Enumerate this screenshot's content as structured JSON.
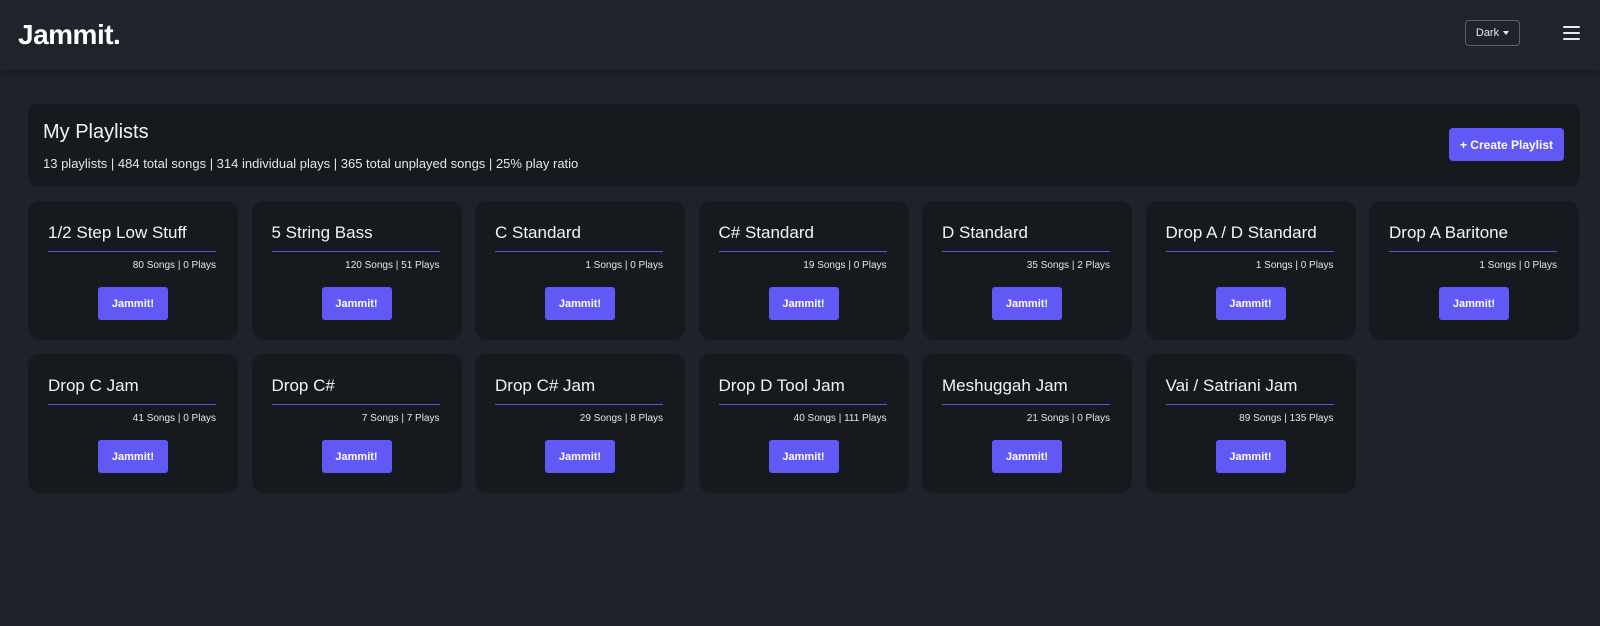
{
  "navbar": {
    "brand": "Jammit.",
    "theme_label": "Dark",
    "menu_icon": "hamburger-menu-icon",
    "caret_icon": "caret-down-icon"
  },
  "summary": {
    "title": "My Playlists",
    "stats": "13 playlists | 484 total songs | 314 individual plays | 365 total unplayed songs | 25% play ratio",
    "create_label": "+ Create Playlist"
  },
  "playlists": [
    {
      "name": "1/2 Step Low Stuff",
      "stats": "80 Songs | 0 Plays",
      "button": "Jammit!"
    },
    {
      "name": "5 String Bass",
      "stats": "120 Songs | 51 Plays",
      "button": "Jammit!"
    },
    {
      "name": "C Standard",
      "stats": "1 Songs | 0 Plays",
      "button": "Jammit!"
    },
    {
      "name": "C# Standard",
      "stats": "19 Songs | 0 Plays",
      "button": "Jammit!"
    },
    {
      "name": "D Standard",
      "stats": "35 Songs | 2 Plays",
      "button": "Jammit!"
    },
    {
      "name": "Drop A / D Standard",
      "stats": "1 Songs | 0 Plays",
      "button": "Jammit!"
    },
    {
      "name": "Drop A Baritone",
      "stats": "1 Songs | 0 Plays",
      "button": "Jammit!"
    },
    {
      "name": "Drop C Jam",
      "stats": "41 Songs | 0 Plays",
      "button": "Jammit!"
    },
    {
      "name": "Drop C#",
      "stats": "7 Songs | 7 Plays",
      "button": "Jammit!"
    },
    {
      "name": "Drop C# Jam",
      "stats": "29 Songs | 8 Plays",
      "button": "Jammit!"
    },
    {
      "name": "Drop D Tool Jam",
      "stats": "40 Songs | 111 Plays",
      "button": "Jammit!"
    },
    {
      "name": "Meshuggah Jam",
      "stats": "21 Songs | 0 Plays",
      "button": "Jammit!"
    },
    {
      "name": "Vai / Satriani Jam",
      "stats": "89 Songs | 135 Plays",
      "button": "Jammit!"
    }
  ],
  "colors": {
    "background": "#1e222a",
    "card": "#16191e",
    "accent": "#6159f5"
  }
}
